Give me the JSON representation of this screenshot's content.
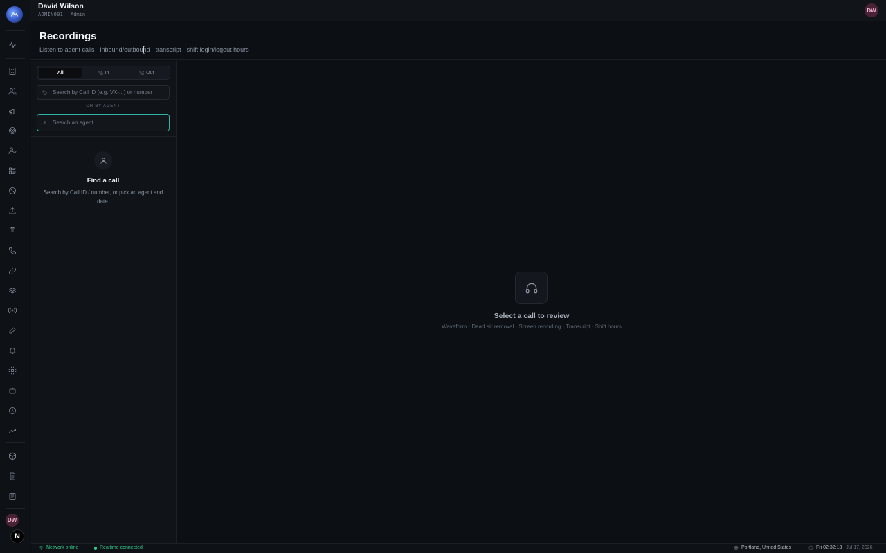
{
  "user": {
    "name": "David Wilson",
    "id": "ADMIN001",
    "role": "Admin",
    "initials": "DW"
  },
  "brand": {
    "mark": "N"
  },
  "rail_icons": [
    "activity-icon",
    "building-icon",
    "users-icon",
    "megaphone-icon",
    "target-icon",
    "user-check-icon",
    "list-icon",
    "ban-icon",
    "upload-icon",
    "clipboard-icon",
    "phone-icon",
    "link-icon",
    "layers-icon",
    "broadcast-icon",
    "pen-icon",
    "bell-icon",
    "chip-icon",
    "bot-icon",
    "clock-icon",
    "trending-icon",
    "package-icon",
    "document-icon",
    "report-icon"
  ],
  "page": {
    "title": "Recordings",
    "subtitle": "Listen to agent calls · inbound/outbound · transcript · shift login/logout hours"
  },
  "filters": {
    "tabs": [
      {
        "label": "All"
      },
      {
        "label": "In"
      },
      {
        "label": "Out"
      }
    ],
    "active_tab": "All",
    "call_search_placeholder": "Search by Call ID (e.g. VX-...) or number",
    "or_by_agent": "OR BY AGENT",
    "agent_search_placeholder": "Search an agent..."
  },
  "find": {
    "title": "Find a call",
    "description": "Search by Call ID / number, or pick an agent and date."
  },
  "empty": {
    "title": "Select a call to review",
    "subtitle": "Waveform · Dead air removal · Screen recording · Transcript · Shift hours"
  },
  "status": {
    "network": "Network online",
    "realtime": "Realtime connected",
    "location": "Portland, United States",
    "time": "Fri 02:32:13",
    "date": "Jul 17, 2026"
  },
  "colors": {
    "accent": "#2fb3a6",
    "online": "#34c98a",
    "avatar_bg": "#4a2238"
  }
}
